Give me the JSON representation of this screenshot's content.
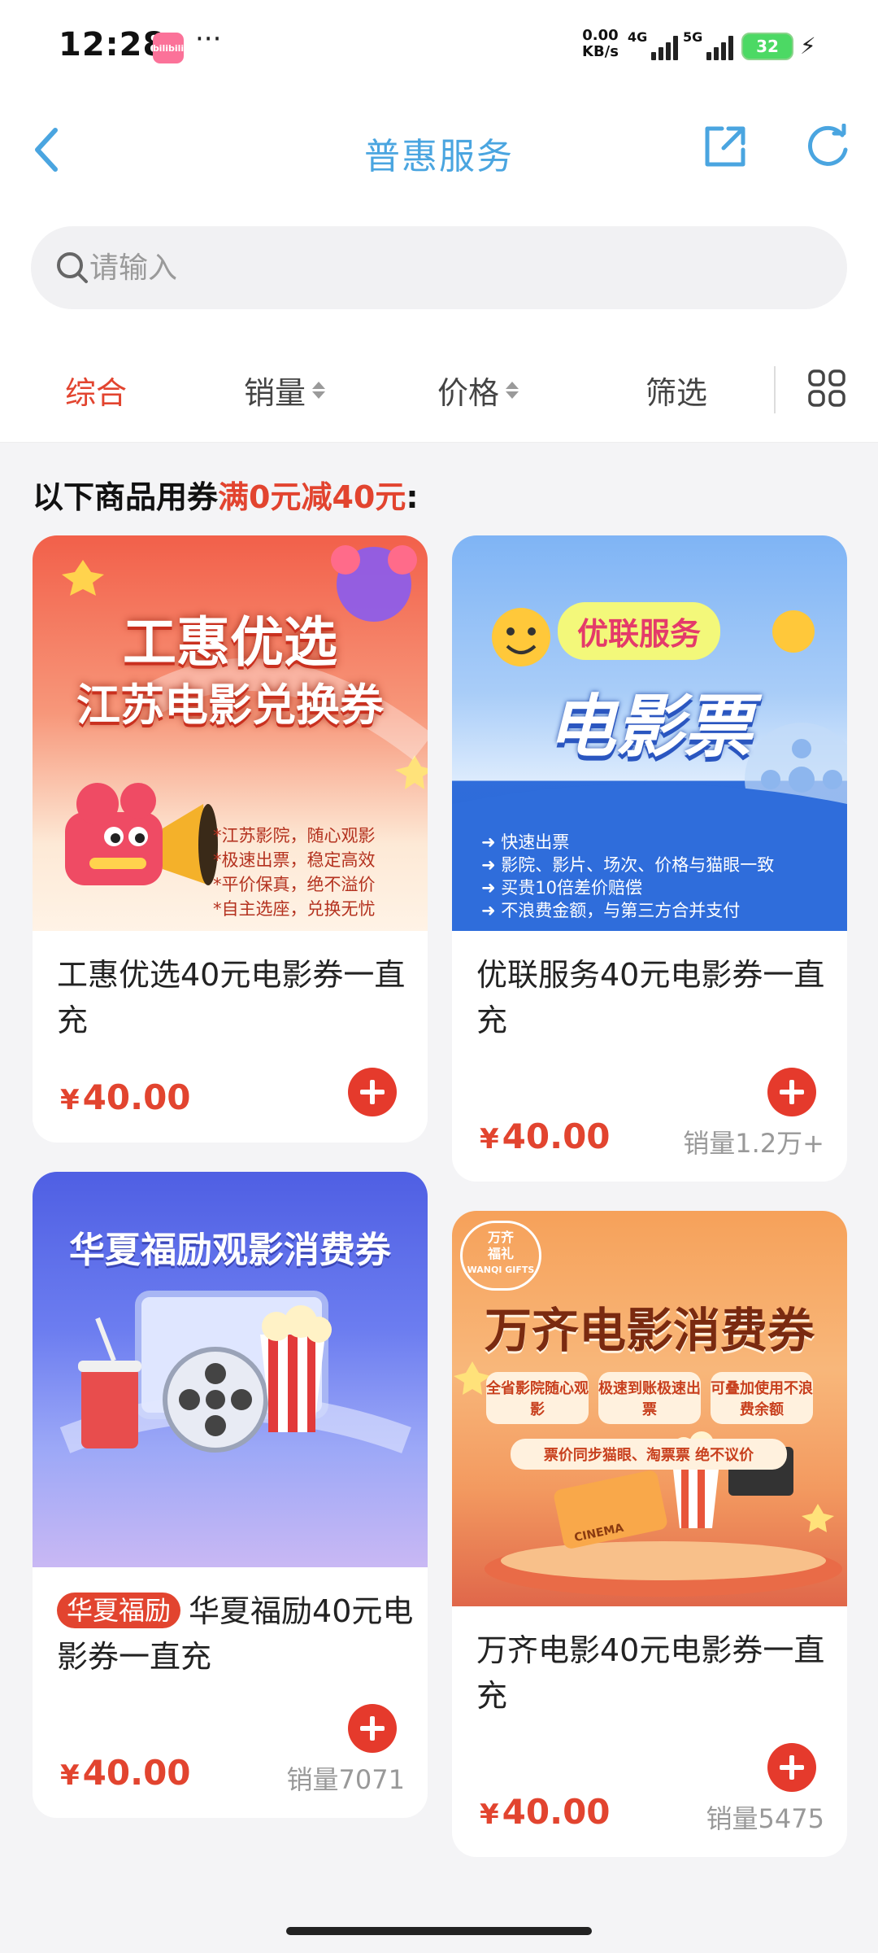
{
  "status": {
    "time": "12:28",
    "app_badge": "bilibili",
    "dots": "···",
    "net_speed_value": "0.00",
    "net_speed_unit": "KB/s",
    "sig1_label": "4G",
    "sig2_label": "5G",
    "battery": "32"
  },
  "nav": {
    "title": "普惠服务"
  },
  "search": {
    "placeholder": "请输入"
  },
  "sort": {
    "items": [
      "综合",
      "销量",
      "价格",
      "筛选"
    ]
  },
  "coupon_note": {
    "prefix": "以下商品用券",
    "highlight": "满0元减40元",
    "suffix": ":"
  },
  "colors": {
    "accent": "#e2442f",
    "nav_title": "#4aa5e0"
  },
  "products": [
    {
      "title": "工惠优选40元电影券一直充",
      "price": "40.00",
      "currency": "¥",
      "sales": "",
      "image": {
        "line1": "工惠优选",
        "line2": "江苏电影兑换券",
        "bullets": [
          "*江苏影院，随心观影",
          "*极速出票，稳定高效",
          "*平价保真，绝不溢价",
          "*自主选座，兑换无忧"
        ]
      }
    },
    {
      "title": "优联服务40元电影券一直充",
      "price": "40.00",
      "currency": "¥",
      "sales": "销量1.2万+",
      "image": {
        "badge": "优联服务",
        "headline": "电影票",
        "bullets": [
          "快速出票",
          "影院、影片、场次、价格与猫眼一致",
          "买贵10倍差价赔偿",
          "不浪费金额，与第三方合并支付"
        ]
      }
    },
    {
      "title": "华夏福励40元电影券一直充",
      "tag": "华夏福励",
      "price": "40.00",
      "currency": "¥",
      "sales": "销量7071",
      "image": {
        "headline": "华夏福励观影消费券"
      }
    },
    {
      "title": "万齐电影40元电影券一直充",
      "price": "40.00",
      "currency": "¥",
      "sales": "销量5475",
      "image": {
        "logo_line1": "万齐",
        "logo_line2": "福礼",
        "logo_line3": "WANQI GIFTS",
        "headline": "万齐电影消费券",
        "features": [
          "全省影院随心观影",
          "极速到账极速出票",
          "可叠加使用不浪费余额"
        ],
        "note": "票价同步猫眼、淘票票 绝不议价",
        "ticket": "CINEMA"
      }
    }
  ]
}
